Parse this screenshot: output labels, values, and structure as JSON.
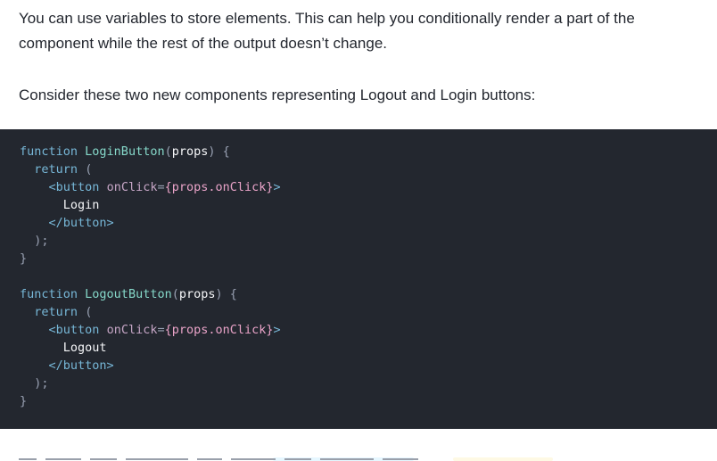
{
  "doc": {
    "paragraph_1": "You can use variables to store elements. This can help you conditionally render a part of the component while the rest of the output doesn’t change.",
    "paragraph_2": "Consider these two new components representing Logout and Login buttons:"
  },
  "code": {
    "lines": [
      "function LoginButton(props) {",
      "  return (",
      "    <button onClick={props.onClick}>",
      "      Login",
      "    </button>",
      "  );",
      "}",
      "",
      "function LogoutButton(props) {",
      "  return (",
      "    <button onClick={props.onClick}>",
      "      Logout",
      "    </button>",
      "  );",
      "}"
    ]
  },
  "colors": {
    "code_background": "#23272f",
    "keyword": "#77b7d7",
    "function_name": "#86d9ca",
    "jsx_attribute": "#c5a5c5",
    "expression": "#e9a3c8",
    "text": "#f6f7f9"
  }
}
